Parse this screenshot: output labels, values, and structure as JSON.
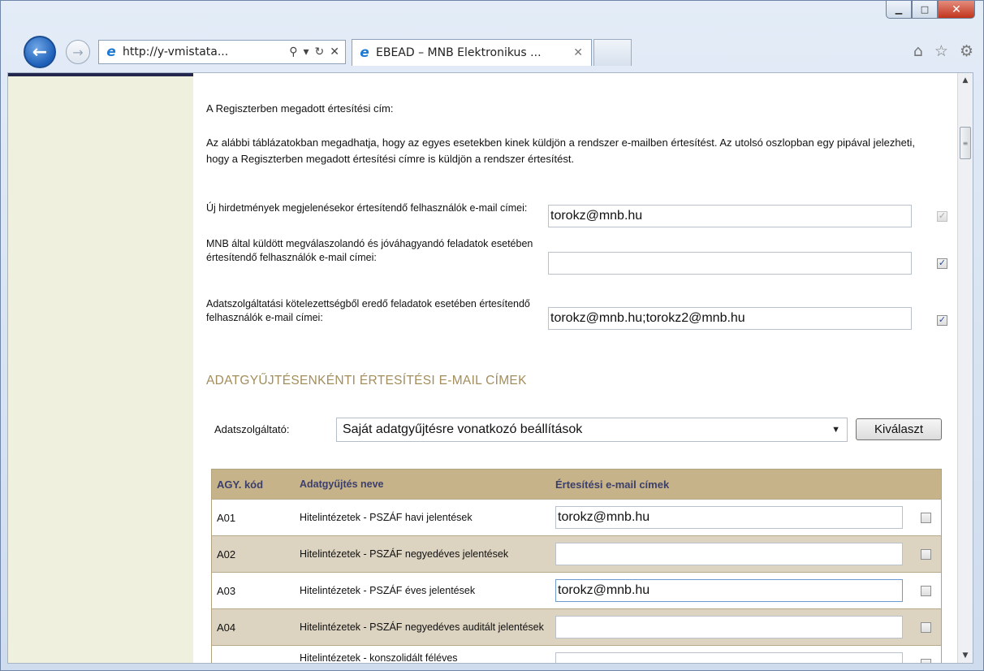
{
  "browser": {
    "address_url": "http://y-vmistata...",
    "tab_title": "EBEAD – MNB Elektronikus ..."
  },
  "page": {
    "notice_address_label": "A Regiszterben megadott értesítési cím:",
    "intro_text": "Az alábbi táblázatokban megadhatja, hogy az egyes esetekben kinek küldjön a rendszer e-mailben értesítést. Az utolsó oszlopban egy pipával jelezheti, hogy a Regiszterben megadott értesítési címre is küldjön a rendszer értesítést.",
    "general_settings": [
      {
        "label": "Új hirdetmények megjelenésekor értesítendő felhasználók e-mail címei:",
        "value": "torokz@mnb.hu",
        "checked": true,
        "disabled": true
      },
      {
        "label": "MNB által küldött megválaszolandó és jóváhagyandó feladatok esetében értesítendő felhasználók e-mail címei:",
        "value": "",
        "checked": true,
        "disabled": false
      },
      {
        "label": "Adatszolgáltatási kötelezettségből eredő feladatok esetében értesítendő felhasználók e-mail címei:",
        "value": "torokz@mnb.hu;torokz2@mnb.hu",
        "checked": true,
        "disabled": false
      }
    ],
    "section_heading": "ADATGYŰJTÉSENKÉNTI ÉRTESÍTÉSI E-MAIL CÍMEK",
    "provider_label": "Adatszolgáltató:",
    "provider_selected": "Saját adatgyűjtésre vonatkozó beállítások",
    "select_button": "Kiválaszt",
    "table": {
      "headers": [
        "AGY. kód",
        "Adatgyűjtés neve",
        "Értesítési e-mail címek"
      ],
      "rows": [
        {
          "code": "A01",
          "name": "Hitelintézetek - PSZÁF havi jelentések",
          "email": "torokz@mnb.hu",
          "checked": false
        },
        {
          "code": "A02",
          "name": "Hitelintézetek - PSZÁF negyedéves jelentések",
          "email": "",
          "checked": false
        },
        {
          "code": "A03",
          "name": "Hitelintézetek - PSZÁF éves jelentések",
          "email": "torokz@mnb.hu",
          "checked": false
        },
        {
          "code": "A04",
          "name": "Hitelintézetek - PSZÁF negyedéves auditált jelentések",
          "email": "",
          "checked": false
        },
        {
          "code": "",
          "name": "Hitelintézetek - konszolidált féléves",
          "email": "",
          "checked": false
        }
      ]
    }
  },
  "colors": {
    "heading": "#a38d5b",
    "table_header": "#c6b38a",
    "row_alt": "#dcd3c0",
    "left_panel": "#f0f0de"
  }
}
